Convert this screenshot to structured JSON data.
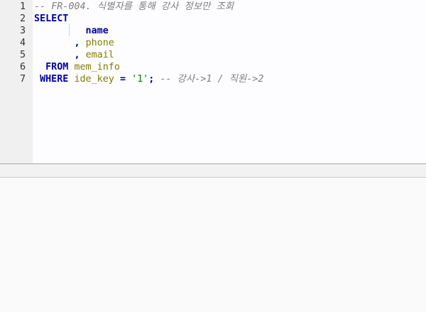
{
  "editor": {
    "lines": [
      {
        "num": "1",
        "tokens": [
          {
            "cls": "cm",
            "text": "-- FR-004. 식별자를 통해 강사 정보만 조회"
          }
        ]
      },
      {
        "num": "2",
        "tokens": [
          {
            "cls": "kw",
            "text": "SELECT"
          }
        ]
      },
      {
        "num": "3",
        "tokens": [
          {
            "cls": "plain",
            "text": "        "
          },
          {
            "cls": "kw",
            "text": " name"
          }
        ]
      },
      {
        "num": "4",
        "tokens": [
          {
            "cls": "plain",
            "text": "       "
          },
          {
            "cls": "op",
            "text": ", "
          },
          {
            "cls": "id",
            "text": "phone"
          }
        ]
      },
      {
        "num": "5",
        "tokens": [
          {
            "cls": "plain",
            "text": "       "
          },
          {
            "cls": "op",
            "text": ", "
          },
          {
            "cls": "id",
            "text": "email"
          }
        ]
      },
      {
        "num": "6",
        "tokens": [
          {
            "cls": "plain",
            "text": "  "
          },
          {
            "cls": "kw",
            "text": "FROM "
          },
          {
            "cls": "id",
            "text": "mem_info"
          }
        ]
      },
      {
        "num": "7",
        "tokens": [
          {
            "cls": "plain",
            "text": " "
          },
          {
            "cls": "kw",
            "text": "WHERE "
          },
          {
            "cls": "id",
            "text": "ide_key "
          },
          {
            "cls": "op",
            "text": "= "
          },
          {
            "cls": "str",
            "text": "'1'"
          },
          {
            "cls": "op",
            "text": "; "
          },
          {
            "cls": "cm",
            "text": "-- 강사->1 / 직원->2"
          }
        ]
      }
    ]
  }
}
